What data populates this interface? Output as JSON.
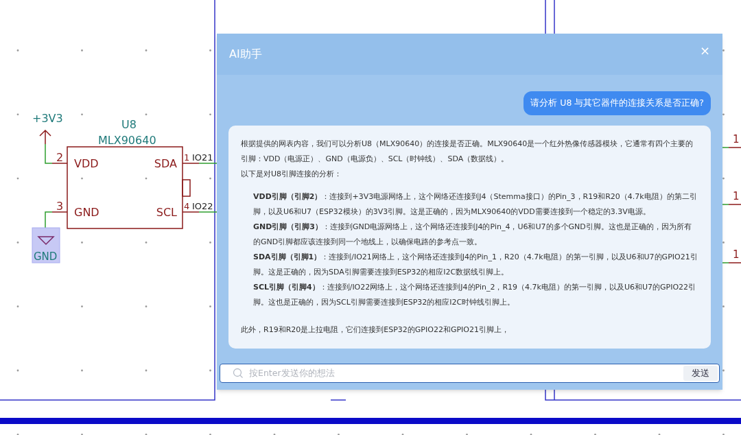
{
  "schematic": {
    "power_label": "+3V3",
    "reference": "U8",
    "value": "MLX90640",
    "left_pins": [
      {
        "number": "2",
        "name": "VDD"
      },
      {
        "number": "3",
        "name": "GND"
      }
    ],
    "right_pins": [
      {
        "number": "1",
        "name": "SDA",
        "net": "IO21"
      },
      {
        "number": "4",
        "name": "SCL",
        "net": "IO22"
      }
    ],
    "ground": {
      "label": "GND",
      "selected": true
    },
    "edge_pins": [
      "1",
      "1",
      "1"
    ]
  },
  "assistant": {
    "title": "AI助手",
    "close": "×",
    "question": "请分析 U8 与其它器件的连接关系是否正确?",
    "answer": {
      "intro": "根据提供的网表内容，我们可以分析U8（MLX90640）的连接是否正确。MLX90640是一个红外热像传感器模块，它通常有四个主要的引脚：VDD（电源正）、GND（电源负）、SCL（时钟线）、SDA（数据线）。",
      "lead": "以下是对U8引脚连接的分析：",
      "items": [
        "**VDD引脚（引脚2）**：连接到+3V3电源网络上，这个网络还连接到J4（Stemma接口）的Pin_3，R19和R20（4.7k电阻）的第二引脚，以及U6和U7（ESP32模块）的3V3引脚。这是正确的，因为MLX90640的VDD需要连接到一个稳定的3.3V电源。",
        "**GND引脚（引脚3）**：连接到GND电源网络上，这个网络还连接到J4的Pin_4，U6和U7的多个GND引脚。这也是正确的，因为所有的GND引脚都应该连接到同一个地线上，以确保电路的参考点一致。",
        "**SDA引脚（引脚1）**：连接到/IO21网络上，这个网络还连接到J4的Pin_1，R20（4.7k电阻）的第一引脚，以及U6和U7的GPIO21引脚。这是正确的，因为SDA引脚需要连接到ESP32的相应I2C数据线引脚上。",
        "**SCL引脚（引脚4）**：连接到/IO22网络上，这个网络还连接到J4的Pin_2，R19（4.7k电阻）的第一引脚，以及U6和U7的GPIO22引脚。这也是正确的，因为SCL引脚需要连接到ESP32的相应I2C时钟线引脚上。"
      ],
      "closing": "此外，R19和R20是上拉电阻，它们连接到ESP32的GPIO22和GPIO21引脚上，"
    },
    "input": {
      "placeholder": "按Enter发送你的想法",
      "send": "发送"
    }
  }
}
